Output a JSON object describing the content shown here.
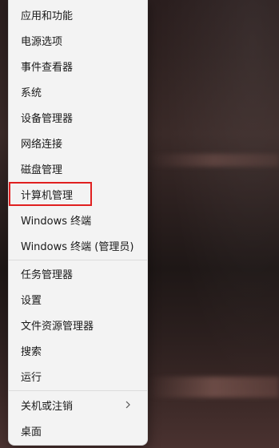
{
  "menu": {
    "group1": [
      {
        "name": "apps-and-features",
        "label": "应用和功能"
      },
      {
        "name": "power-options",
        "label": "电源选项"
      },
      {
        "name": "event-viewer",
        "label": "事件查看器"
      },
      {
        "name": "system",
        "label": "系统"
      },
      {
        "name": "device-manager",
        "label": "设备管理器"
      },
      {
        "name": "network-connections",
        "label": "网络连接"
      },
      {
        "name": "disk-management",
        "label": "磁盘管理"
      },
      {
        "name": "computer-management",
        "label": "计算机管理",
        "highlighted": true
      },
      {
        "name": "windows-terminal",
        "label": "Windows 终端"
      },
      {
        "name": "windows-terminal-admin",
        "label": "Windows 终端 (管理员)"
      }
    ],
    "group2": [
      {
        "name": "task-manager",
        "label": "任务管理器"
      },
      {
        "name": "settings",
        "label": "设置"
      },
      {
        "name": "file-explorer",
        "label": "文件资源管理器"
      },
      {
        "name": "search",
        "label": "搜索"
      },
      {
        "name": "run",
        "label": "运行"
      }
    ],
    "group3": [
      {
        "name": "shut-down-or-sign-out",
        "label": "关机或注销",
        "submenu": true,
        "icon": "chevron-right-icon"
      },
      {
        "name": "desktop",
        "label": "桌面"
      }
    ]
  },
  "colors": {
    "highlight_border": "#e02020",
    "menu_background": "#f3f3f3"
  }
}
